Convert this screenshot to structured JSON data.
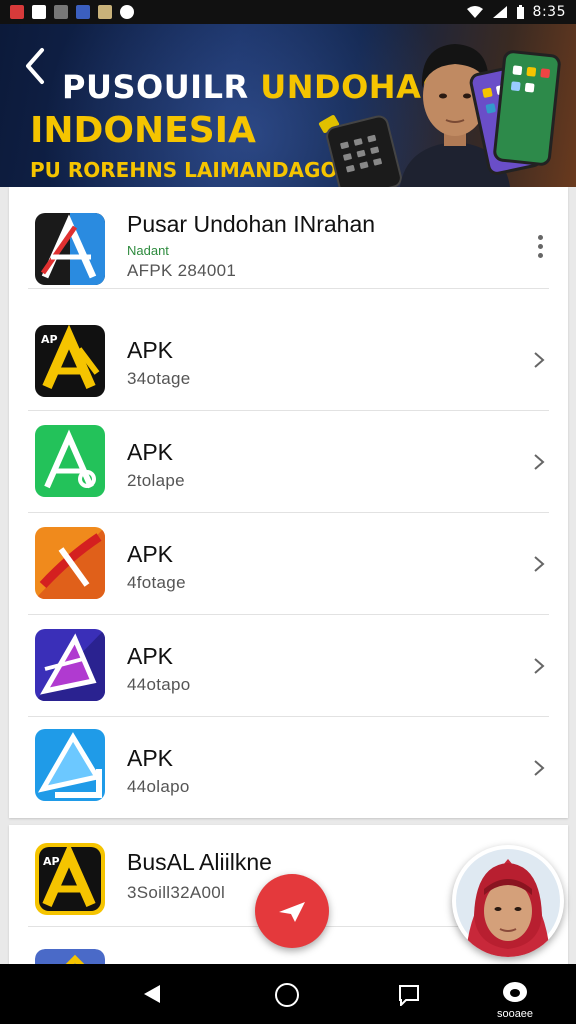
{
  "status_bar": {
    "time": "8:35",
    "notification_icons": [
      "red-app-icon",
      "mail-icon",
      "image-icon",
      "facebook-icon",
      "calendar-icon",
      "record-icon"
    ],
    "right_icons": [
      "wifi-icon",
      "signal-icon",
      "battery-icon"
    ]
  },
  "banner": {
    "title_part1": "PUSOUILR",
    "title_part2": "UNDOHAN",
    "title_line2": "INDONESIA",
    "subtitle": "PU ROREHNS LAIMANDAGOM",
    "colors": {
      "accent": "#f5c400",
      "background": "#0c1a3a"
    }
  },
  "list_1": {
    "items": [
      {
        "title": "Pusar Undohan INrahan",
        "publisher": "Nadant",
        "meta": "AFPK 284001",
        "action": "more-icon",
        "icon": "app-store-icon"
      },
      {
        "title": "APK",
        "meta": "34otage",
        "action": "chevron-right-icon",
        "icon": "yellow-apk-icon"
      },
      {
        "title": "APK",
        "meta": "2tolape",
        "action": "chevron-right-icon",
        "icon": "green-apk-icon"
      },
      {
        "title": "APK",
        "meta": "4fotage",
        "action": "chevron-right-icon",
        "icon": "orange-apk-icon"
      },
      {
        "title": "APK",
        "meta": "44otapo",
        "action": "chevron-right-icon",
        "icon": "purple-apk-icon"
      },
      {
        "title": "APK",
        "meta": "44olapo",
        "action": "chevron-right-icon",
        "icon": "blue-apk-icon"
      }
    ]
  },
  "list_2": {
    "items": [
      {
        "title": "BusAL Aliilkne",
        "meta": "3Soill32A00l",
        "icon": "yellow-apk-icon"
      }
    ]
  },
  "fab": {
    "icon": "paper-plane-icon",
    "color": "#e4393c"
  },
  "nav_bar": {
    "label": "sooaee",
    "icons": [
      "back-triangle-icon",
      "home-circle-icon",
      "recents-chat-icon",
      "profile-icon"
    ]
  }
}
